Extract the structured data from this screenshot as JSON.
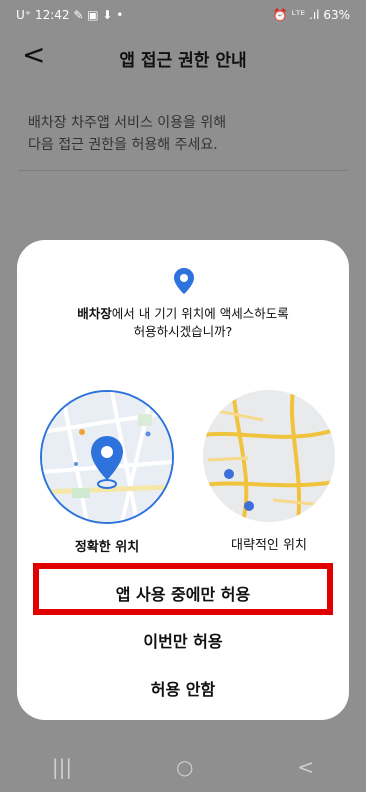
{
  "status": {
    "carrier": "U⁺",
    "time": "12:42",
    "indicators": "✎ ▣ ⬇ •",
    "right_icons": "⏰ ᴸᵀᴱ .ıl",
    "battery": "63%"
  },
  "header": {
    "back_symbol": "<",
    "title": "앱 접근 권한 안내"
  },
  "description": {
    "line1": "배차장 차주앱 서비스 이용을 위해",
    "line2": "다음 접근 권한을 허용해 주세요."
  },
  "dialog": {
    "app_name": "배차장",
    "prompt_rest": "에서 내 기기 위치에 액세스하도록",
    "prompt_line2": "허용하시겠습니까?",
    "options": [
      {
        "label": "정확한 위치",
        "selected": true
      },
      {
        "label": "대략적인 위치",
        "selected": false
      }
    ],
    "buttons": [
      {
        "label": "앱 사용 중에만 허용"
      },
      {
        "label": "이번만 허용"
      },
      {
        "label": "허용 안함"
      }
    ]
  },
  "navbar": {
    "recent": "|||",
    "home": "○",
    "back": "<"
  }
}
